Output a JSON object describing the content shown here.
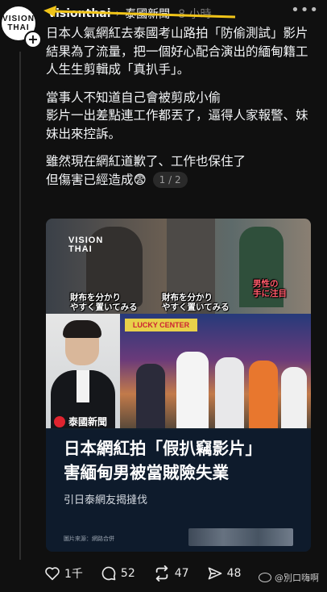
{
  "header": {
    "username": "visionthai",
    "separator": "›",
    "community": "泰國新聞",
    "time": "8 小時",
    "more": "•••"
  },
  "avatar": {
    "line1": "VISION",
    "line2": "THAI"
  },
  "post": {
    "paragraphs": [
      "日本人氣網紅去泰國考山路拍「防偷測試」影片\n結果為了流量，把一個好心配合演出的緬甸籍工人生生剪輯成「真扒手」。",
      "當事人不知道自己會被剪成小偷\n影片一出差點連工作都丟了，逼得人家報警、妹妹出來控訴。",
      "雖然現在網紅道歉了、工作也保住了\n但傷害已經造成😨"
    ],
    "page_indicator": "1 / 2"
  },
  "media": {
    "watermark_line1": "VISION",
    "watermark_line2": "THAI",
    "caption_1": "財布を分かり\nやすく置いてみる",
    "caption_2": "財布を分かり\nやすく置いてみる",
    "caption_3": "男性の\n手に注目",
    "scene_sign": "LUCKY CENTER",
    "logo_text": "泰國新聞",
    "headline_line1": "日本網紅拍「假扒竊影片」",
    "headline_line2": "害緬甸男被當賊險失業",
    "subheadline": "引日泰網友揭撻伐",
    "credit": "圖片來源：網路合併"
  },
  "actions": {
    "likes": "1千",
    "comments": "52",
    "reposts": "47",
    "shares": "48"
  },
  "watermark": {
    "text": "@別口嗨啊"
  },
  "colors": {
    "background": "#101010",
    "text": "#f3f5f7",
    "muted": "#777777",
    "accent_arrow": "#f0c419",
    "news_red": "#e0242f"
  }
}
